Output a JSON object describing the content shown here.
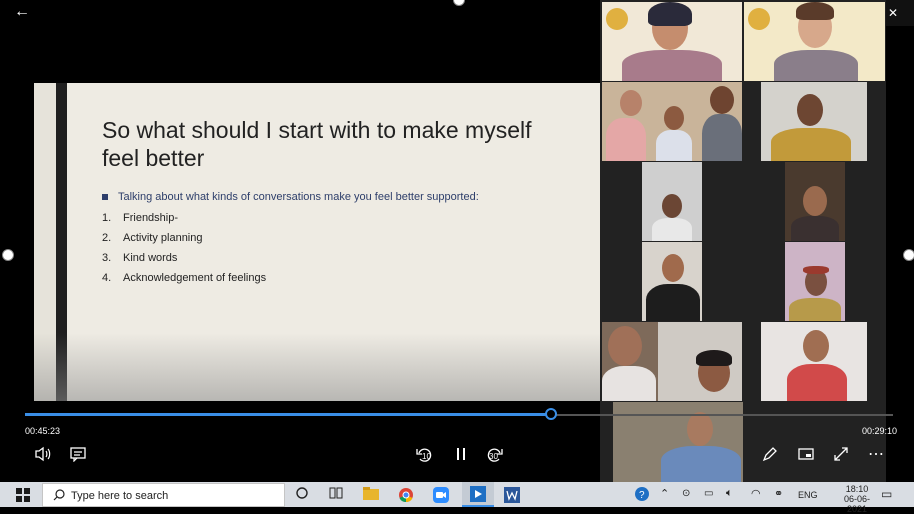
{
  "slide": {
    "title": "So what should I start with to make myself feel better",
    "bullet": "Talking about what kinds of conversations make  you feel better supported:",
    "items": [
      {
        "num": "1.",
        "text": "Friendship-"
      },
      {
        "num": "2.",
        "text": "Activity planning"
      },
      {
        "num": "3.",
        "text": "Kind words"
      },
      {
        "num": "4.",
        "text": "Acknowledgement of feelings"
      }
    ]
  },
  "player": {
    "elapsed": "00:45:23",
    "remaining": "00:29:10",
    "progress_fraction": 0.607,
    "skip_back_label": "10",
    "skip_forward_label": "30"
  },
  "window": {
    "minimize_glyph": "—",
    "restore_glyph": "❐",
    "close_glyph": "✕",
    "back_glyph": "←"
  },
  "taskbar": {
    "search_placeholder": "Type here to search",
    "language": "ENG",
    "time": "18:10",
    "date": "06-06-2021"
  },
  "icons": {
    "accent": "#3a8ee6"
  }
}
